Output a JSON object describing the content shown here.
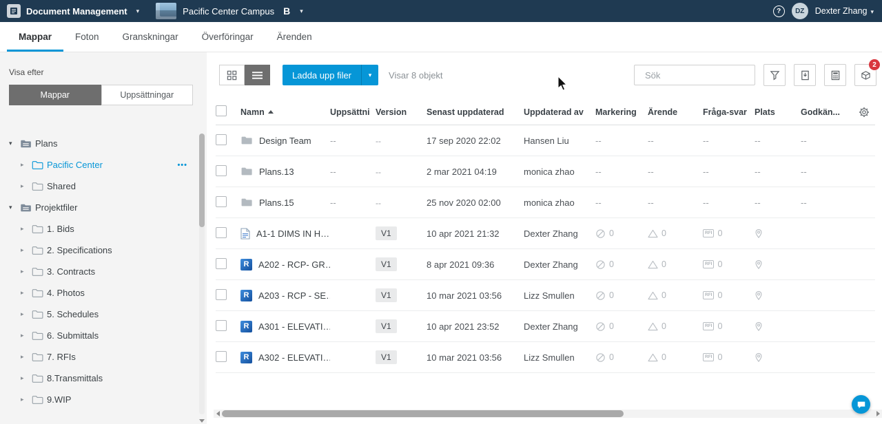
{
  "topbar": {
    "app_title": "Document Management",
    "project_name": "Pacific Center Campus",
    "user_initials": "DZ",
    "user_name": "Dexter Zhang"
  },
  "icons": {
    "help_glyph": "?",
    "product_letter": "B",
    "revit_letter": "R",
    "rfi_label": "RFI"
  },
  "tabs": [
    {
      "label": "Mappar",
      "active": true
    },
    {
      "label": "Foton",
      "active": false
    },
    {
      "label": "Granskningar",
      "active": false
    },
    {
      "label": "Överföringar",
      "active": false
    },
    {
      "label": "Ärenden",
      "active": false
    }
  ],
  "sidebar": {
    "view_by_label": "Visa efter",
    "toggle": [
      {
        "label": "Mappar",
        "active": true
      },
      {
        "label": "Uppsättningar",
        "active": false
      }
    ],
    "tree": [
      {
        "label": "Plans",
        "level": 0,
        "expanded": true,
        "selected": false,
        "menu": false
      },
      {
        "label": "Pacific Center",
        "level": 1,
        "expanded": false,
        "selected": true,
        "menu": true
      },
      {
        "label": "Shared",
        "level": 1,
        "expanded": false,
        "selected": false,
        "menu": false
      },
      {
        "label": "Projektfiler",
        "level": 0,
        "expanded": true,
        "selected": false,
        "menu": false
      },
      {
        "label": "1. Bids",
        "level": 1,
        "expanded": false,
        "selected": false,
        "menu": false
      },
      {
        "label": "2. Specifications",
        "level": 1,
        "expanded": false,
        "selected": false,
        "menu": false
      },
      {
        "label": "3. Contracts",
        "level": 1,
        "expanded": false,
        "selected": false,
        "menu": false
      },
      {
        "label": "4. Photos",
        "level": 1,
        "expanded": false,
        "selected": false,
        "menu": false
      },
      {
        "label": "5. Schedules",
        "level": 1,
        "expanded": false,
        "selected": false,
        "menu": false
      },
      {
        "label": "6. Submittals",
        "level": 1,
        "expanded": false,
        "selected": false,
        "menu": false
      },
      {
        "label": "7. RFIs",
        "level": 1,
        "expanded": false,
        "selected": false,
        "menu": false
      },
      {
        "label": "8.Transmittals",
        "level": 1,
        "expanded": false,
        "selected": false,
        "menu": false
      },
      {
        "label": "9.WIP",
        "level": 1,
        "expanded": false,
        "selected": false,
        "menu": false
      }
    ]
  },
  "toolbar": {
    "upload_button": "Ladda upp filer",
    "items_summary": "Visar 8 objekt",
    "search_placeholder": "Sök",
    "notification_badge": "2"
  },
  "table": {
    "columns": {
      "name": "Namn",
      "set": "Uppsättni",
      "version": "Version",
      "updated": "Senast uppdaterad",
      "updated_by": "Uppdaterad av",
      "markup": "Markering",
      "issue": "Ärende",
      "rfi": "Fråga-svar",
      "location": "Plats",
      "approval": "Godkän..."
    },
    "rows": [
      {
        "icon": "folder",
        "name": "Design Team",
        "set": "--",
        "version": "--",
        "updated": "17 sep 2020 22:02",
        "updated_by": "Hansen Liu",
        "markup": "--",
        "issue": "--",
        "rfi": "--",
        "location": "--",
        "approval": "--"
      },
      {
        "icon": "folder",
        "name": "Plans.13",
        "set": "--",
        "version": "--",
        "updated": "2 mar 2021 04:19",
        "updated_by": "monica zhao",
        "markup": "--",
        "issue": "--",
        "rfi": "--",
        "location": "--",
        "approval": "--"
      },
      {
        "icon": "folder",
        "name": "Plans.15",
        "set": "--",
        "version": "--",
        "updated": "25 nov 2020 02:00",
        "updated_by": "monica zhao",
        "markup": "--",
        "issue": "--",
        "rfi": "--",
        "location": "--",
        "approval": "--"
      },
      {
        "icon": "sheet",
        "name": "A1-1 DIMS IN H…",
        "set": "",
        "version": "V1",
        "updated": "10 apr 2021 21:32",
        "updated_by": "Dexter Zhang",
        "markup": "0",
        "issue": "0",
        "rfi": "0",
        "location": "",
        "approval": ""
      },
      {
        "icon": "revit",
        "name": "A202 - RCP- GR…",
        "set": "",
        "version": "V1",
        "updated": "8 apr 2021 09:36",
        "updated_by": "Dexter Zhang",
        "markup": "0",
        "issue": "0",
        "rfi": "0",
        "location": "",
        "approval": ""
      },
      {
        "icon": "revit",
        "name": "A203 - RCP - SE…",
        "set": "",
        "version": "V1",
        "updated": "10 mar 2021 03:56",
        "updated_by": "Lizz Smullen",
        "markup": "0",
        "issue": "0",
        "rfi": "0",
        "location": "",
        "approval": ""
      },
      {
        "icon": "revit",
        "name": "A301 - ELEVATI…",
        "set": "",
        "version": "V1",
        "updated": "10 apr 2021 23:52",
        "updated_by": "Dexter Zhang",
        "markup": "0",
        "issue": "0",
        "rfi": "0",
        "location": "",
        "approval": ""
      },
      {
        "icon": "revit",
        "name": "A302 - ELEVATI…",
        "set": "",
        "version": "V1",
        "updated": "10 mar 2021 03:56",
        "updated_by": "Lizz Smullen",
        "markup": "0",
        "issue": "0",
        "rfi": "0",
        "location": "",
        "approval": ""
      }
    ]
  },
  "colors": {
    "accent": "#0696d7",
    "topbar_bg": "#1f3a52",
    "badge_red": "#d9363e"
  }
}
